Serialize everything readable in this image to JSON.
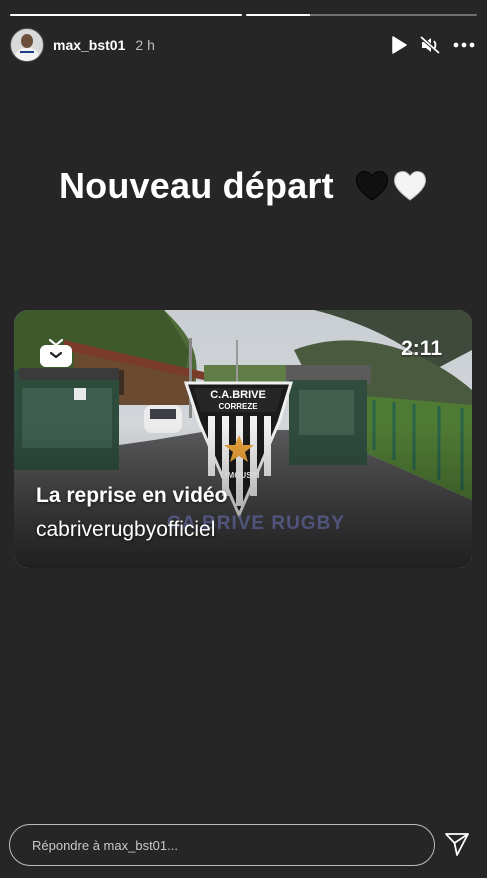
{
  "progress": {
    "segments": [
      {
        "fill": 1.0
      },
      {
        "fill": 0.28
      }
    ]
  },
  "header": {
    "username": "max_bst01",
    "time": "2 h"
  },
  "story": {
    "headline": "Nouveau départ",
    "hearts": [
      "black-heart-icon",
      "white-heart-icon"
    ]
  },
  "shared_post": {
    "duration": "2:11",
    "title": "La reprise en vidéo",
    "account": "cabriverugbyofficiel",
    "club_name": "C.A.BRIVE",
    "club_region": "CORREZE",
    "club_area": "LIMOUSIN",
    "banner": "CA BRIVE RUGBY"
  },
  "reply": {
    "placeholder": "Répondre à max_bst01..."
  },
  "colors": {
    "background": "#262626",
    "text": "#ffffff"
  }
}
